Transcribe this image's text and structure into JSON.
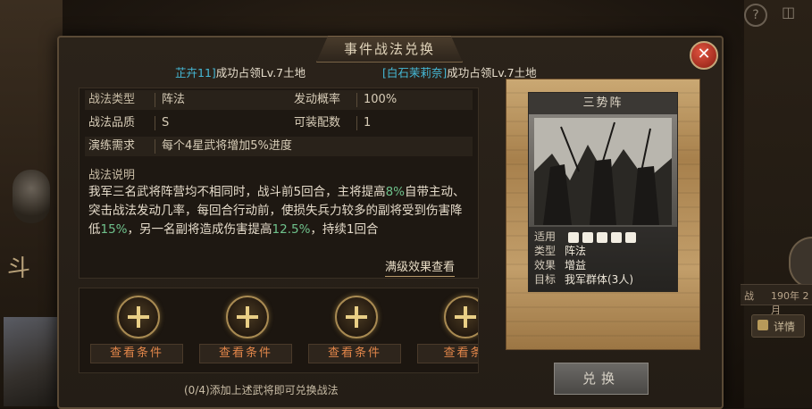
{
  "window": {
    "title": "事件战法兑换"
  },
  "background": {
    "left_char": "斗",
    "date_a": "战",
    "date_b": "190年 2月",
    "detail_label": "详情"
  },
  "notices": [
    {
      "name": "芷卉11]",
      "text": "成功占领Lv.7土地"
    },
    {
      "name": "[白石茉莉奈]",
      "text": "成功占领Lv.7土地"
    }
  ],
  "tactic": {
    "type_label": "战法类型",
    "type_value": "阵法",
    "prob_label": "发动概率",
    "prob_value": "100%",
    "quality_label": "战法品质",
    "quality_value": "S",
    "equip_label": "可装配数",
    "equip_value": "1",
    "train_label": "演练需求",
    "train_value": "每个4星武将增加5%进度",
    "desc_title": "战法说明",
    "desc_parts": {
      "p1": "我军三名武将阵营均不相同时，战斗前5回合，主将提高",
      "g1": "8%",
      "p2": "自带主动、突击战法发动几率，每回合行动前，使损失兵力较多的副将受到伤害降低",
      "g2": "15%",
      "p3": "，另一名副将造成伤害提高",
      "g3": "12.5%",
      "p4": "，持续1回合"
    },
    "full_effect_link": "满级效果查看"
  },
  "slots": {
    "condition_label": "查看条件",
    "labels": [
      "查看条件",
      "查看条件",
      "查看条件",
      "查看条"
    ],
    "hint": "(0/4)添加上述武将即可兑换战法"
  },
  "card": {
    "name": "三势阵",
    "applicable_label": "适用",
    "applicable_icons": [
      "cavalry-icon",
      "shield-icon",
      "bow-icon",
      "spear-icon",
      "siege-icon"
    ],
    "type_label": "类型",
    "type_value": "阵法",
    "effect_label": "效果",
    "effect_value": "增益",
    "target_label": "目标",
    "target_value": "我军群体(3人)"
  },
  "exchange_button": "兑换",
  "colors": {
    "accent_green": "#6fc28c",
    "name_cyan": "#45b8d6",
    "condition_orange": "#e2864a"
  }
}
